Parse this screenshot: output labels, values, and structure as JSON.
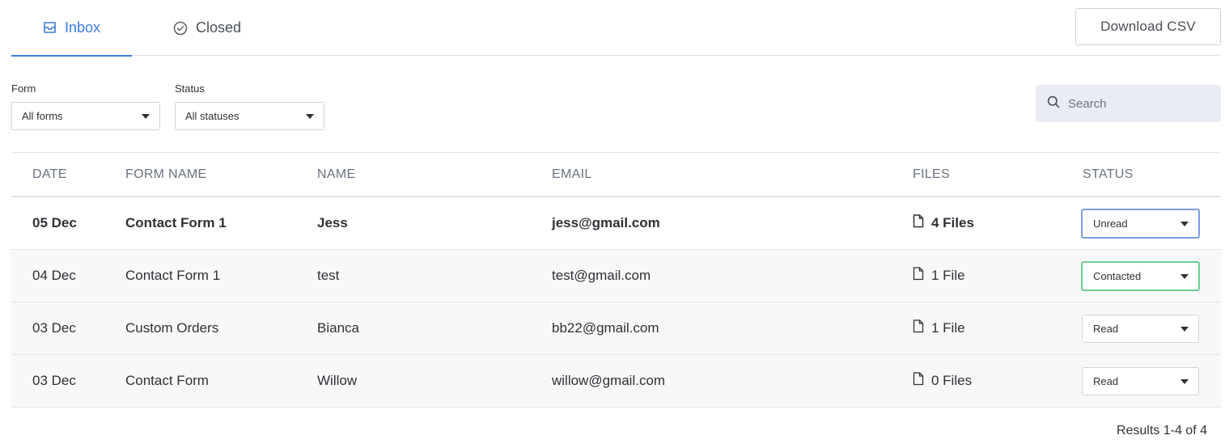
{
  "tabs": [
    {
      "label": "Inbox",
      "icon": "inbox-icon",
      "active": true
    },
    {
      "label": "Closed",
      "icon": "check-circle-icon",
      "active": false
    }
  ],
  "download_label": "Download CSV",
  "filters": {
    "form_label": "Form",
    "form_value": "All forms",
    "status_label": "Status",
    "status_value": "All statuses"
  },
  "search": {
    "placeholder": "Search"
  },
  "table": {
    "columns": [
      "DATE",
      "FORM NAME",
      "NAME",
      "EMAIL",
      "FILES",
      "STATUS"
    ],
    "rows": [
      {
        "date": "05 Dec",
        "form": "Contact Form 1",
        "name": "Jess",
        "email": "jess@gmail.com",
        "files": "4 Files",
        "status": "Unread"
      },
      {
        "date": "04 Dec",
        "form": "Contact Form 1",
        "name": "test",
        "email": "test@gmail.com",
        "files": "1 File",
        "status": "Contacted"
      },
      {
        "date": "03 Dec",
        "form": "Custom Orders",
        "name": "Bianca",
        "email": "bb22@gmail.com",
        "files": "1 File",
        "status": "Read"
      },
      {
        "date": "03 Dec",
        "form": "Contact Form",
        "name": "Willow",
        "email": "willow@gmail.com",
        "files": "0 Files",
        "status": "Read"
      }
    ]
  },
  "results_text": "Results 1-4 of 4",
  "colors": {
    "accent": "#3e7be0",
    "contacted": "#6fce8f",
    "unread_focus": "#7b9ee6"
  }
}
